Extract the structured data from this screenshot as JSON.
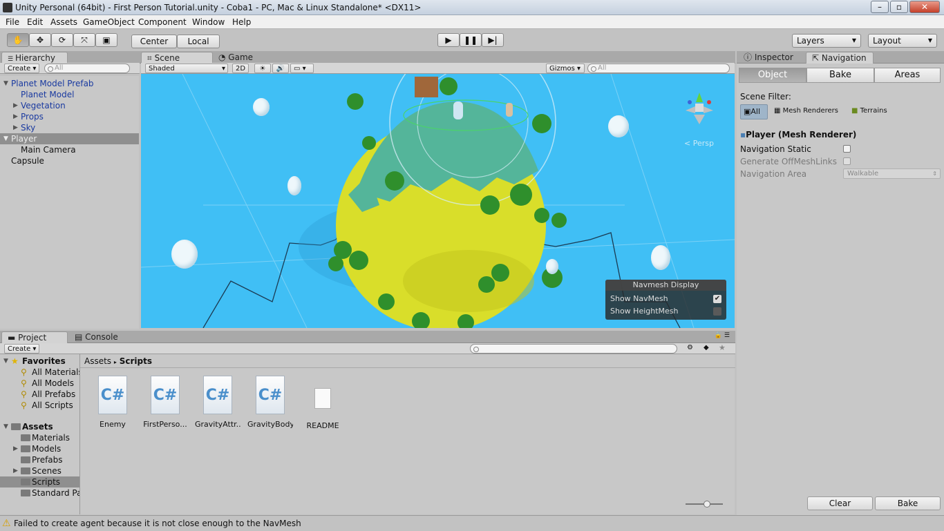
{
  "window": {
    "title": "Unity Personal (64bit) - First Person Tutorial.unity - Coba1 - PC, Mac & Linux Standalone* <DX11>"
  },
  "menu": [
    "File",
    "Edit",
    "Assets",
    "GameObject",
    "Component",
    "Window",
    "Help"
  ],
  "toolbar": {
    "center": "Center",
    "local": "Local",
    "layers": "Layers",
    "layout": "Layout"
  },
  "hierarchy": {
    "tab": "Hierarchy",
    "create": "Create",
    "search_placeholder": "All",
    "items": [
      {
        "label": "Planet Model Prefab"
      },
      {
        "label": "Planet Model"
      },
      {
        "label": "Vegetation"
      },
      {
        "label": "Props"
      },
      {
        "label": "Sky"
      },
      {
        "label": "Player"
      },
      {
        "label": "Main Camera"
      },
      {
        "label": "Capsule"
      }
    ]
  },
  "scene": {
    "tab": "Scene",
    "game_tab": "Game",
    "shading": "Shaded",
    "mode2d": "2D",
    "gizmos": "Gizmos",
    "search_placeholder": "All",
    "persp": "Persp",
    "navmesh_display": {
      "title": "Navmesh Display",
      "show_navmesh": "Show NavMesh",
      "show_heightmesh": "Show HeightMesh"
    }
  },
  "project": {
    "tab": "Project",
    "console_tab": "Console",
    "create": "Create",
    "favorites": {
      "label": "Favorites",
      "items": [
        "All Materials",
        "All Models",
        "All Prefabs",
        "All Scripts"
      ]
    },
    "assets": {
      "label": "Assets",
      "items": [
        "Materials",
        "Models",
        "Prefabs",
        "Scenes",
        "Scripts",
        "Standard Pa"
      ]
    },
    "breadcrumb": {
      "root": "Assets",
      "current": "Scripts"
    },
    "files": [
      {
        "label": "Enemy",
        "icon": "C#"
      },
      {
        "label": "FirstPerso...",
        "icon": "C#"
      },
      {
        "label": "GravityAttr...",
        "icon": "C#"
      },
      {
        "label": "GravityBody",
        "icon": "C#"
      },
      {
        "label": "README",
        "icon": ""
      }
    ]
  },
  "inspector": {
    "tab": "Inspector",
    "nav_tab": "Navigation",
    "segments": {
      "object": "Object",
      "bake": "Bake",
      "areas": "Areas"
    },
    "scene_filter": "Scene Filter:",
    "filters": {
      "all": "All",
      "mesh": "Mesh Renderers",
      "terrains": "Terrains"
    },
    "component_title": "Player (Mesh Renderer)",
    "nav_static": "Navigation Static",
    "gen_offmesh": "Generate OffMeshLinks",
    "nav_area": "Navigation Area",
    "nav_area_value": "Walkable",
    "clear": "Clear",
    "bake": "Bake"
  },
  "status": {
    "message": "Failed to create agent because it is not close enough to the NavMesh"
  }
}
